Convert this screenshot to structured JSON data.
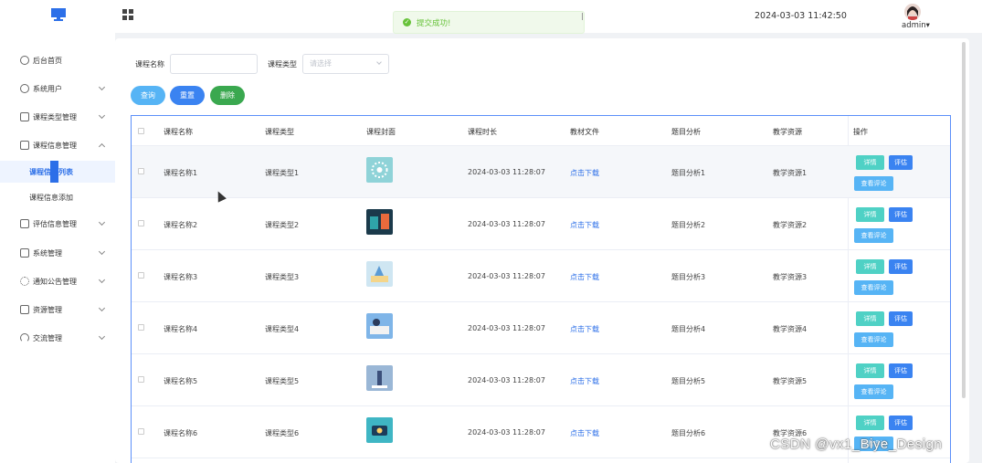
{
  "toast": {
    "message": "提交成功!",
    "status_color": "#67c23a"
  },
  "header": {
    "datetime": "2024-03-03 11:42:50",
    "user": "admin",
    "user_caret": "▾"
  },
  "sidebar": {
    "items": [
      {
        "label": "后台首页",
        "icon": "clock-icon"
      },
      {
        "label": "系统用户",
        "icon": "user-icon"
      },
      {
        "label": "课程类型管理",
        "icon": "folder-icon"
      },
      {
        "label": "课程信息管理",
        "icon": "folder-icon",
        "expanded": true
      },
      {
        "label": "评估信息管理",
        "icon": "folder-icon"
      },
      {
        "label": "系统管理",
        "icon": "folder-icon"
      },
      {
        "label": "通知公告管理",
        "icon": "broadcast-icon"
      },
      {
        "label": "资源管理",
        "icon": "box-icon"
      },
      {
        "label": "交流管理",
        "icon": "headphones-icon"
      }
    ],
    "subitems": [
      {
        "label": "课程信息列表",
        "active": true
      },
      {
        "label": "课程信息添加",
        "active": false
      }
    ],
    "accent": "#2c6fe8"
  },
  "search": {
    "name_label": "课程名称",
    "name_value": "",
    "type_label": "课程类型",
    "type_placeholder": "请选择",
    "query_label": "查询",
    "reset_label": "重置",
    "delete_label": "删除"
  },
  "table": {
    "headers": [
      "课程名称",
      "课程类型",
      "课程封面",
      "课程时长",
      "教材文件",
      "题目分析",
      "教学资源",
      "操作"
    ],
    "rows": [
      {
        "name": "课程名称1",
        "type": "课程类型1",
        "cover": "cover-1",
        "duration": "2024-03-03 11:28:07",
        "file": "点击下载",
        "analysis": "题目分析1",
        "resource": "教学资源1"
      },
      {
        "name": "课程名称2",
        "type": "课程类型2",
        "cover": "cover-2",
        "duration": "2024-03-03 11:28:07",
        "file": "点击下载",
        "analysis": "题目分析2",
        "resource": "教学资源2"
      },
      {
        "name": "课程名称3",
        "type": "课程类型3",
        "cover": "cover-3",
        "duration": "2024-03-03 11:28:07",
        "file": "点击下载",
        "analysis": "题目分析3",
        "resource": "教学资源3"
      },
      {
        "name": "课程名称4",
        "type": "课程类型4",
        "cover": "cover-4",
        "duration": "2024-03-03 11:28:07",
        "file": "点击下载",
        "analysis": "题目分析4",
        "resource": "教学资源4"
      },
      {
        "name": "课程名称5",
        "type": "课程类型5",
        "cover": "cover-5",
        "duration": "2024-03-03 11:28:07",
        "file": "点击下载",
        "analysis": "题目分析5",
        "resource": "教学资源5"
      },
      {
        "name": "课程名称6",
        "type": "课程类型6",
        "cover": "cover-6",
        "duration": "2024-03-03 11:28:07",
        "file": "点击下载",
        "analysis": "题目分析6",
        "resource": "教学资源6"
      }
    ],
    "actions": {
      "detail": "详情",
      "evaluate": "评估",
      "view_review": "查看评论"
    }
  },
  "colors": {
    "teal": "#4fd1c5",
    "blue": "#3a83f1",
    "green": "#3aa84f",
    "light_blue": "#56b4f5"
  },
  "watermark": "CSDN @vx1_Biye_Design"
}
